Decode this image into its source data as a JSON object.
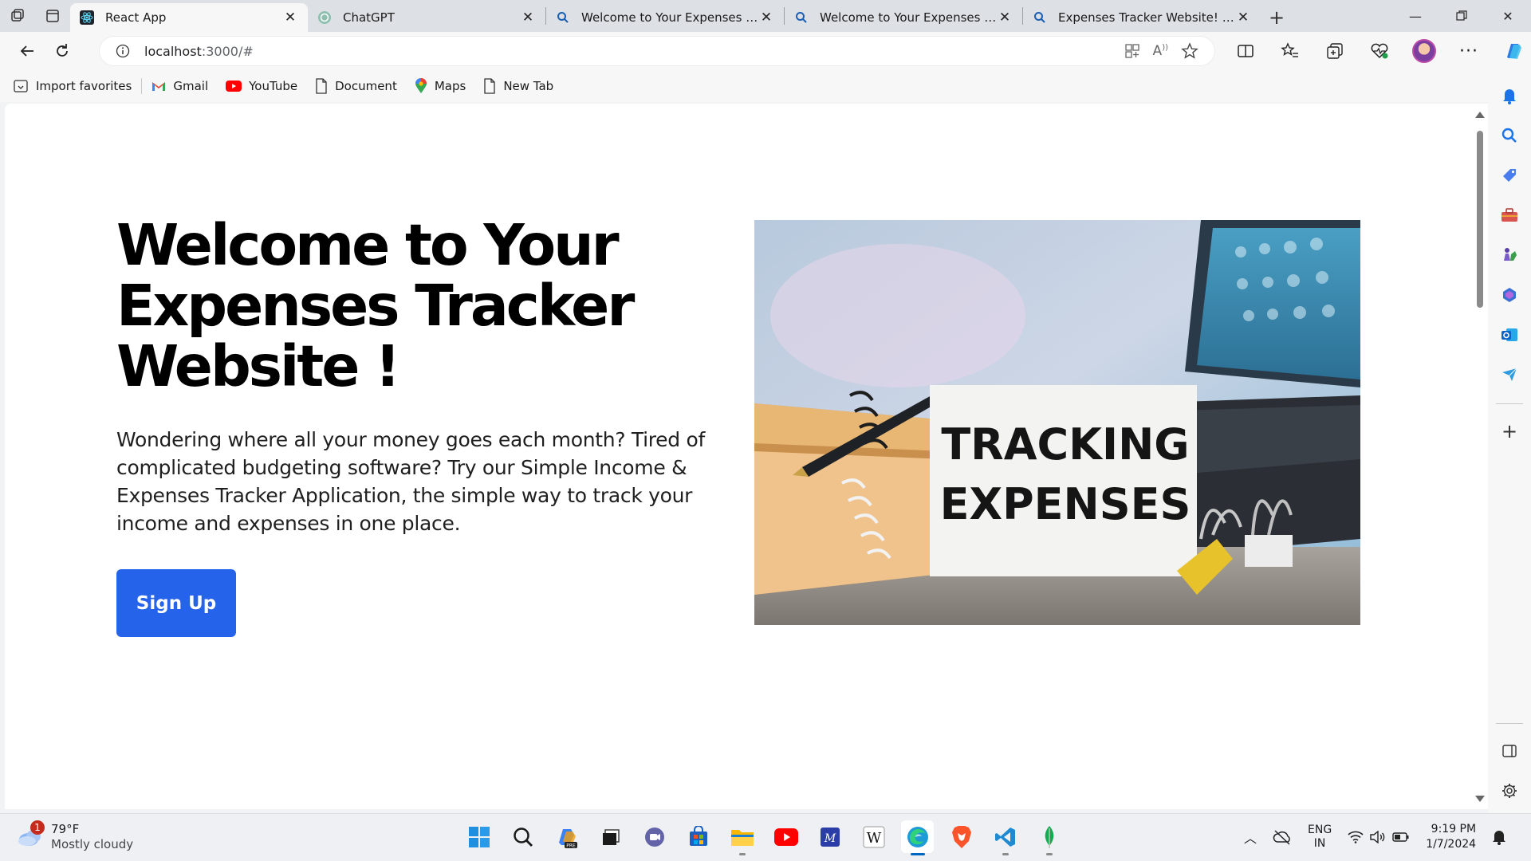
{
  "browser": {
    "tabs": [
      {
        "title": "React App",
        "active": true,
        "icon": "react-icon"
      },
      {
        "title": "ChatGPT",
        "active": false,
        "icon": "chatgpt-icon"
      },
      {
        "title": "Welcome to Your Expenses Tracke",
        "active": false,
        "icon": "search-icon"
      },
      {
        "title": "Welcome to Your Expenses Tracke",
        "active": false,
        "icon": "search-icon"
      },
      {
        "title": "Expenses Tracker Website! blue c",
        "active": false,
        "icon": "search-icon"
      }
    ],
    "address": {
      "host": "localhost",
      "path": ":3000/#"
    },
    "favorites": [
      {
        "label": "Import favorites",
        "icon": "import-icon"
      },
      {
        "label": "Gmail",
        "icon": "gmail-icon"
      },
      {
        "label": "YouTube",
        "icon": "youtube-icon"
      },
      {
        "label": "Document",
        "icon": "document-icon"
      },
      {
        "label": "Maps",
        "icon": "maps-icon"
      },
      {
        "label": "New Tab",
        "icon": "document-icon"
      }
    ]
  },
  "page": {
    "title": "Welcome to Your Expenses Tracker Website !",
    "description": "Wondering where all your money goes each month? Tired of complicated budgeting software? Try our Simple Income & Expenses Tracker Application, the simple way to track your income and expenses in one place.",
    "signup_label": "Sign Up",
    "image": {
      "card_line1": "TRACKING",
      "card_line2": "EXPENSES"
    }
  },
  "taskbar": {
    "weather": {
      "temp": "79°F",
      "condition": "Mostly cloudy",
      "badge": "1"
    },
    "language": {
      "line1": "ENG",
      "line2": "IN"
    },
    "time": "9:19 PM",
    "date": "1/7/2024"
  },
  "colors": {
    "primary_button": "#2563eb",
    "tab_strip": "#dde0e5"
  }
}
